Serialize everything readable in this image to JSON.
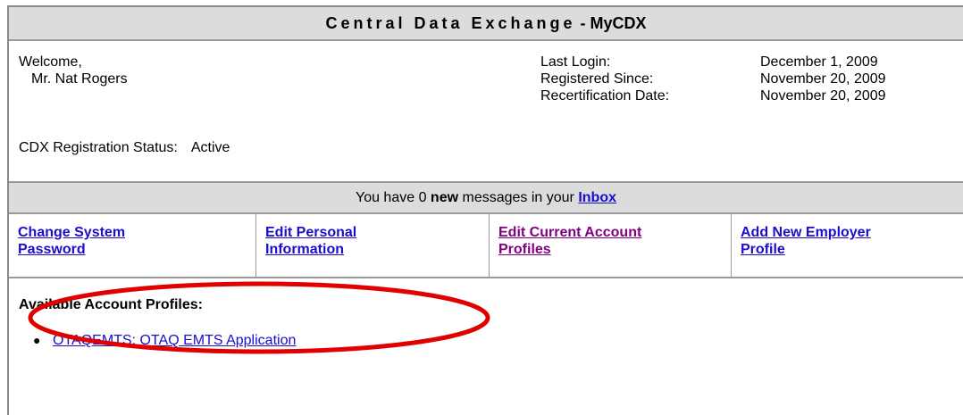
{
  "app": {
    "title_part1": "Central Data Exchange",
    "title_sep": " - ",
    "title_part2": "MyCDX"
  },
  "user": {
    "welcome": "Welcome,",
    "name": "Mr. Nat Rogers",
    "last_login_label": "Last Login:",
    "last_login": "December 1, 2009",
    "registered_since_label": "Registered Since:",
    "registered_since": "November 20, 2009",
    "recertification_label": "Recertification Date:",
    "recertification_date": "November 20, 2009",
    "status_label": "CDX Registration Status:",
    "status": "Active"
  },
  "messages": {
    "prefix": "You have 0 ",
    "new_word": "new",
    "middle": " messages in your ",
    "inbox_label": "Inbox"
  },
  "actions": [
    {
      "label": "Change System Password"
    },
    {
      "label": "Edit Personal Information"
    },
    {
      "label": "Edit Current Account Profiles"
    },
    {
      "label": "Add New Employer Profile"
    }
  ],
  "profiles": {
    "heading": "Available Account Profiles:",
    "items": [
      "OTAQEMTS: OTAQ EMTS Application"
    ]
  },
  "colors": {
    "link": "#1a0dcc",
    "visited_link": "#800080",
    "annotation": "#e00000",
    "bar_background": "#dcdcdc"
  }
}
